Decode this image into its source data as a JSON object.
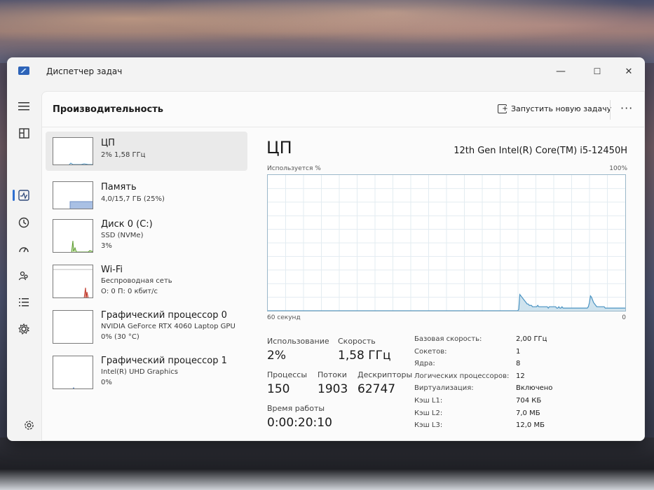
{
  "window": {
    "title": "Диспетчер задач",
    "minimize": "—",
    "maximize": "☐",
    "close": "✕"
  },
  "header": {
    "page_title": "Производительность",
    "new_task_label": "Запустить новую задачу",
    "more": "···"
  },
  "perf_list": [
    {
      "name": "ЦП",
      "sub1": "2% 1,58 ГГц",
      "sub2": ""
    },
    {
      "name": "Память",
      "sub1": "4,0/15,7 ГБ (25%)",
      "sub2": ""
    },
    {
      "name": "Диск 0 (C:)",
      "sub1": "SSD (NVMe)",
      "sub2": "3%"
    },
    {
      "name": "Wi-Fi",
      "sub1": "Беспроводная сеть",
      "sub2": "О: 0 П: 0 кбит/с"
    },
    {
      "name": "Графический процессор 0",
      "sub1": "NVIDIA GeForce RTX 4060 Laptop GPU",
      "sub2": "0% (30 °C)"
    },
    {
      "name": "Графический процессор 1",
      "sub1": "Intel(R) UHD Graphics",
      "sub2": "0%"
    }
  ],
  "cpu": {
    "title": "ЦП",
    "model": "12th Gen Intel(R) Core(TM) i5-12450H",
    "graph_label": "Используется %",
    "graph_max": "100%",
    "graph_x_left": "60 секунд",
    "graph_x_right": "0",
    "graph_color": "#4a93c2",
    "graph_fill": "#cfe3ee",
    "usage_history": [
      0,
      0,
      0,
      0,
      0,
      0,
      0,
      0,
      0,
      0,
      0,
      0,
      0,
      0,
      0,
      0,
      0,
      0,
      0,
      0,
      0,
      0,
      0,
      0,
      0,
      0,
      0,
      0,
      0,
      0,
      0,
      0,
      0,
      0,
      0,
      0,
      0,
      0,
      0,
      0,
      0,
      0,
      0,
      0,
      0,
      0,
      0,
      0,
      0,
      0,
      0,
      0,
      0,
      0,
      0,
      0,
      0,
      0,
      0,
      0,
      0,
      0,
      0,
      0,
      0,
      0,
      0,
      0,
      0,
      0,
      0,
      0,
      0,
      0,
      0,
      0,
      0,
      0,
      0,
      0,
      0,
      0,
      0,
      0,
      0,
      0,
      0,
      0,
      0,
      0,
      0,
      0,
      0,
      0,
      0,
      0,
      0,
      0,
      0,
      0,
      0,
      0,
      0,
      0,
      0,
      0,
      0,
      0,
      0,
      0,
      0,
      0,
      0,
      0,
      0,
      0,
      0,
      0,
      0,
      0,
      0,
      0,
      0,
      0,
      0,
      0,
      0,
      0,
      0,
      0,
      0,
      0,
      0,
      0,
      0,
      0,
      0,
      0,
      0,
      0,
      0,
      0,
      0,
      0,
      0,
      0,
      0,
      0,
      0,
      0,
      0,
      0,
      0,
      0,
      0,
      0,
      0,
      0,
      0,
      0,
      0,
      0,
      0,
      0,
      0,
      0,
      0,
      0,
      0,
      0,
      0,
      0,
      0,
      0,
      0,
      0,
      0,
      0,
      0,
      0,
      0,
      0,
      0,
      0,
      0,
      0,
      0,
      0,
      0,
      0,
      0,
      0,
      0,
      0,
      0,
      0,
      0,
      0,
      0,
      0,
      0,
      0,
      0,
      0,
      0,
      0,
      0,
      0,
      0,
      0,
      0,
      0,
      0,
      0,
      0,
      0,
      0,
      0,
      0,
      0,
      0,
      0,
      0,
      0,
      0,
      0,
      0,
      0,
      0,
      0,
      0,
      0,
      0,
      0,
      0,
      0,
      0,
      0,
      1,
      12,
      11,
      10,
      9,
      8,
      7,
      6,
      5,
      5,
      4,
      4,
      4,
      3,
      3,
      3,
      3,
      3,
      4,
      3,
      3,
      3,
      3,
      3,
      3,
      3,
      3,
      3,
      2,
      3,
      3,
      3,
      3,
      3,
      3,
      3,
      2,
      2,
      3,
      2,
      2,
      3,
      2,
      2,
      2,
      2,
      2,
      2,
      2,
      2,
      2,
      2,
      2,
      2,
      2,
      2,
      2,
      2,
      2,
      2,
      2,
      2,
      2,
      2,
      2,
      2,
      3,
      6,
      11,
      10,
      8,
      6,
      5,
      4,
      3,
      3,
      3,
      3,
      3,
      3,
      3,
      3,
      2,
      2,
      2,
      2,
      2,
      2,
      2,
      2,
      2,
      2,
      2,
      2,
      2,
      2,
      2,
      2,
      2,
      2,
      2,
      2
    ],
    "stats": {
      "usage_label": "Использование",
      "usage_value": "2%",
      "speed_label": "Скорость",
      "speed_value": "1,58 ГГц",
      "processes_label": "Процессы",
      "processes_value": "150",
      "threads_label": "Потоки",
      "threads_value": "1903",
      "handles_label": "Дескрипторы",
      "handles_value": "62747",
      "uptime_label": "Время работы",
      "uptime_value": "0:00:20:10"
    },
    "specs": [
      {
        "label": "Базовая скорость:",
        "value": "2,00 ГГц"
      },
      {
        "label": "Сокетов:",
        "value": "1"
      },
      {
        "label": "Ядра:",
        "value": "8"
      },
      {
        "label": "Логических процессоров:",
        "value": "12"
      },
      {
        "label": "Виртуализация:",
        "value": "Включено"
      },
      {
        "label": "Кэш L1:",
        "value": "704 КБ"
      },
      {
        "label": "Кэш L2:",
        "value": "7,0 МБ"
      },
      {
        "label": "Кэш L3:",
        "value": "12,0 МБ"
      }
    ]
  },
  "sidebar_icons": [
    "menu-icon",
    "processes-icon",
    "performance-icon",
    "app-history-icon",
    "startup-apps-icon",
    "users-icon",
    "details-icon",
    "services-icon",
    "settings-icon"
  ]
}
